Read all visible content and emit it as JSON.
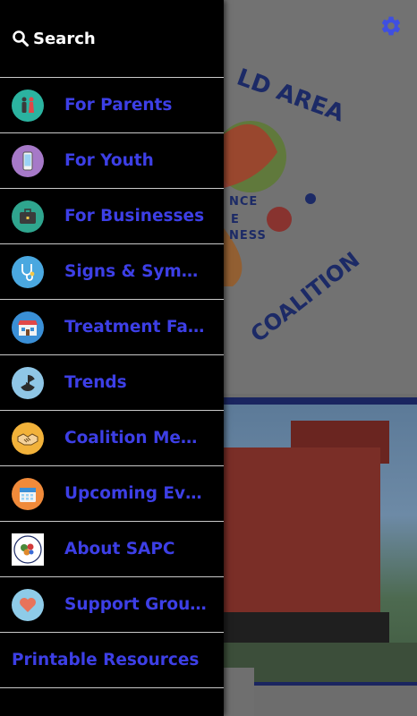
{
  "drawer": {
    "search_label": "Search",
    "items": [
      {
        "label": "For Parents",
        "icon": "parents-icon",
        "color": "#2bb3a0"
      },
      {
        "label": "For Youth",
        "icon": "phone-icon",
        "color": "#a679c8"
      },
      {
        "label": "For Businesses",
        "icon": "briefcase-icon",
        "color": "#2fa58e"
      },
      {
        "label": "Signs & Sympt…",
        "icon": "stethoscope-icon",
        "color": "#4aa8e0"
      },
      {
        "label": "Treatment Faci…",
        "icon": "building-icon",
        "color": "#3a8fd6"
      },
      {
        "label": "Trends",
        "icon": "radiation-icon",
        "color": "#8fc6e6"
      },
      {
        "label": "Coalition Mem…",
        "icon": "handshake-icon",
        "color": "#f2b23a"
      },
      {
        "label": "Upcoming Events",
        "icon": "calendar-icon",
        "color": "#f08a3a"
      },
      {
        "label": "About SAPC",
        "icon": "sapc-logo-icon",
        "color": "#ffffff"
      },
      {
        "label": "Support Groups",
        "icon": "heart-icon",
        "color": "#8ecbe8"
      }
    ],
    "printable_label": "Printable Resources"
  },
  "background": {
    "logo_words": [
      "LD AREA",
      "COALITION"
    ],
    "logo_small": [
      "NCE",
      "E",
      "NESS"
    ]
  },
  "colors": {
    "accent": "#3d3fe6",
    "gear": "#3f4fe0",
    "drawer_bg": "#000000",
    "divider": "#c9c9c9"
  }
}
